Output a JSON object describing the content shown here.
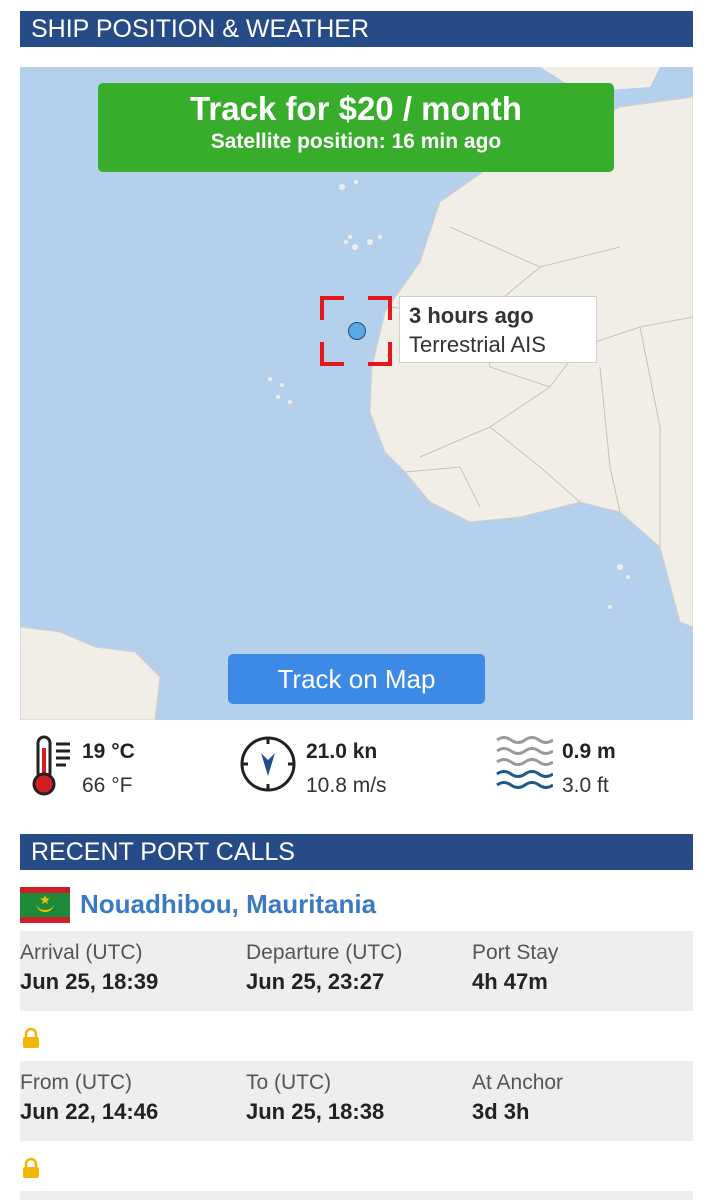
{
  "sections": {
    "position_header": "SHIP POSITION & WEATHER",
    "port_calls_header": "RECENT PORT CALLS"
  },
  "promo": {
    "title": "Track for $20 / month",
    "subtitle": "Satellite position: 16 min ago"
  },
  "position_label": {
    "time": "3 hours ago",
    "source": "Terrestrial AIS"
  },
  "track_button": "Track on Map",
  "weather": {
    "temperature_c": "19 °C",
    "temperature_f": "66 °F",
    "wind_kn": "21.0 kn",
    "wind_ms": "10.8 m/s",
    "wave_m": "0.9 m",
    "wave_ft": "3.0 ft",
    "icons": [
      "thermometer-icon",
      "compass-icon",
      "waves-icon"
    ]
  },
  "port_call": {
    "name": "Nouadhibou, Mauritania",
    "flag": "mauritania-flag",
    "visit": {
      "arrival_label": "Arrival (UTC)",
      "arrival_value": "Jun 25, 18:39",
      "departure_label": "Departure (UTC)",
      "departure_value": "Jun 25, 23:27",
      "stay_label": "Port Stay",
      "stay_value": "4h 47m"
    },
    "anchor": {
      "from_label": "From (UTC)",
      "from_value": "Jun 22, 14:46",
      "to_label": "To (UTC)",
      "to_value": "Jun 25, 18:38",
      "anchor_label": "At Anchor",
      "anchor_value": "3d 3h"
    }
  },
  "colors": {
    "header_bg": "#274b86",
    "promo_green": "#37ad2b",
    "button_blue": "#3d8ae6",
    "ocean": "#b5d0ed",
    "land": "#f1eee8",
    "lock_gold": "#f2b705"
  }
}
